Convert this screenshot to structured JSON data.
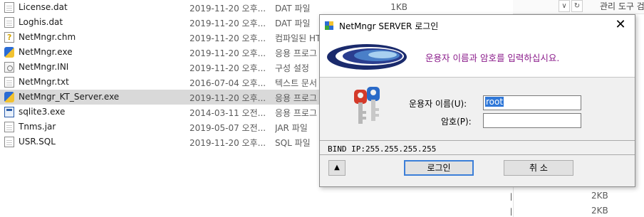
{
  "explorer": {
    "files": [
      {
        "name": "License.dat",
        "date": "2019-11-20 오후...",
        "type": "DAT 파일",
        "size": "1KB",
        "icon": "document-icon"
      },
      {
        "name": "Loghis.dat",
        "date": "2019-11-20 오후...",
        "type": "DAT 파일",
        "size": "",
        "icon": "document-icon"
      },
      {
        "name": "NetMngr.chm",
        "date": "2019-11-20 오후...",
        "type": "컴파일된 HT",
        "size": "",
        "icon": "help-file-icon"
      },
      {
        "name": "NetMngr.exe",
        "date": "2019-11-20 오후...",
        "type": "응용 프로그",
        "size": "",
        "icon": "application-icon"
      },
      {
        "name": "NetMngr.INI",
        "date": "2019-11-20 오후...",
        "type": "구성 설정",
        "size": "",
        "icon": "settings-file-icon"
      },
      {
        "name": "NetMngr.txt",
        "date": "2016-07-04 오후...",
        "type": "텍스트 문서",
        "size": "",
        "icon": "text-file-icon"
      },
      {
        "name": "NetMngr_KT_Server.exe",
        "date": "2019-11-20 오후...",
        "type": "응용 프로그",
        "size": "",
        "icon": "application-icon",
        "selected": true
      },
      {
        "name": "sqlite3.exe",
        "date": "2014-03-11 오전...",
        "type": "응용 프로그",
        "size": "",
        "icon": "console-app-icon"
      },
      {
        "name": "Tnms.jar",
        "date": "2019-05-07 오전...",
        "type": "JAR 파일",
        "size": "",
        "icon": "document-icon"
      },
      {
        "name": "USR.SQL",
        "date": "2019-11-20 오후...",
        "type": "SQL 파일",
        "size": "",
        "icon": "document-icon"
      }
    ],
    "ribbon_label": "관리 도구 검",
    "refresh_glyph": "↻",
    "dropdown_glyph": "∨",
    "partial_sizes": [
      "2KB",
      "2KB"
    ],
    "partial_marks": [
      "ㅣ",
      "ㅣ"
    ]
  },
  "dialog": {
    "title": "NetMngr SERVER 로그인",
    "close_glyph": "✕",
    "banner_message": "운용자 이름과 암호를 입력하십시요.",
    "username_label": "운용자 이름(U):",
    "username_value": "root",
    "password_label": "암호(P):",
    "password_value": "",
    "bind_info": "BIND IP:255.255.255.255",
    "toggle_glyph": "▲",
    "login_label": "로그인",
    "cancel_label": "취 소"
  }
}
